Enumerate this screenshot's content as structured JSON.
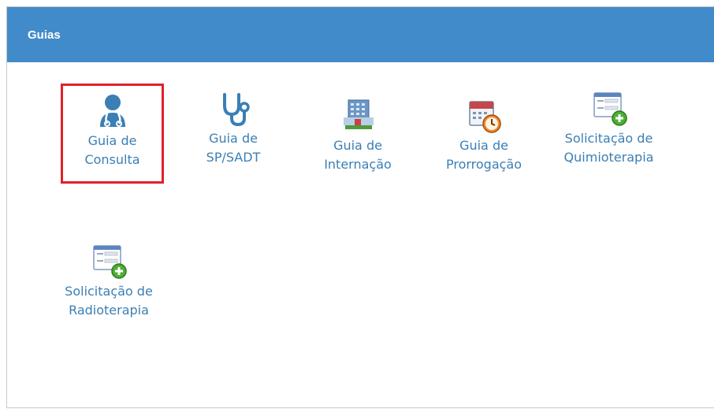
{
  "panel": {
    "title": "Guias"
  },
  "tiles": [
    {
      "line1": "Guia de",
      "line2": "Consulta",
      "icon": "doctor-icon"
    },
    {
      "line1": "Guia de",
      "line2": "SP/SADT",
      "icon": "stethoscope-icon"
    },
    {
      "line1": "Guia de",
      "line2": "Internação",
      "icon": "hospital-icon"
    },
    {
      "line1": "Guia de",
      "line2": "Prorrogação",
      "icon": "calendar-clock-icon"
    },
    {
      "line1": "Solicitação de",
      "line2": "Quimioterapia",
      "icon": "form-add-icon"
    },
    {
      "line1": "Solicitação de",
      "line2": "Radioterapia",
      "icon": "form-add-icon"
    }
  ],
  "selected_tile": "Guia de Consulta",
  "colors": {
    "header": "#428bca",
    "label": "#3a7fb5",
    "selection": "#e3202a"
  }
}
